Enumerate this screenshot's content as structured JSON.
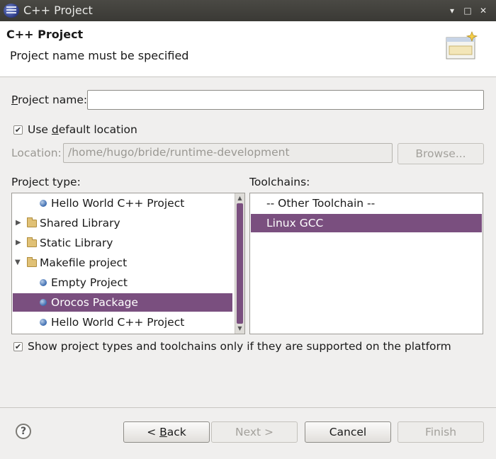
{
  "window": {
    "title": "C++ Project",
    "controls": {
      "minimize": "▾",
      "maximize": "□",
      "close": "✕"
    }
  },
  "banner": {
    "heading": "C++ Project",
    "message": "Project name must be specified"
  },
  "project_name": {
    "label_accel": "P",
    "label_rest": "roject name:",
    "value": ""
  },
  "use_default_location": {
    "checked": true,
    "label_pre": "Use ",
    "label_accel": "d",
    "label_rest": "efault location"
  },
  "location": {
    "label": "Location:",
    "value": "/home/hugo/bride/runtime-development",
    "browse": "Browse..."
  },
  "project_type": {
    "label": "Project type:",
    "items": [
      {
        "label": "Hello World C++ Project",
        "kind": "leaf"
      },
      {
        "label": "Shared Library",
        "kind": "folder"
      },
      {
        "label": "Static Library",
        "kind": "folder"
      },
      {
        "label": "Makefile project",
        "kind": "folder-open"
      },
      {
        "label": "Empty Project",
        "kind": "leaf"
      },
      {
        "label": "Orocos Package",
        "kind": "leaf",
        "selected": true
      },
      {
        "label": "Hello World C++ Project",
        "kind": "leaf"
      }
    ]
  },
  "toolchains": {
    "label": "Toolchains:",
    "items": [
      {
        "label": "-- Other Toolchain --"
      },
      {
        "label": "Linux GCC",
        "selected": true
      }
    ]
  },
  "show_supported": {
    "checked": true,
    "label": "Show project types and toolchains only if they are supported on the platform"
  },
  "buttons": {
    "help": "?",
    "back_pre": "< ",
    "back_accel": "B",
    "back_rest": "ack",
    "next": "Next >",
    "cancel": "Cancel",
    "finish": "Finish"
  },
  "colors": {
    "selection": "#7a4f7f",
    "titlebar": "#3e3d39"
  }
}
